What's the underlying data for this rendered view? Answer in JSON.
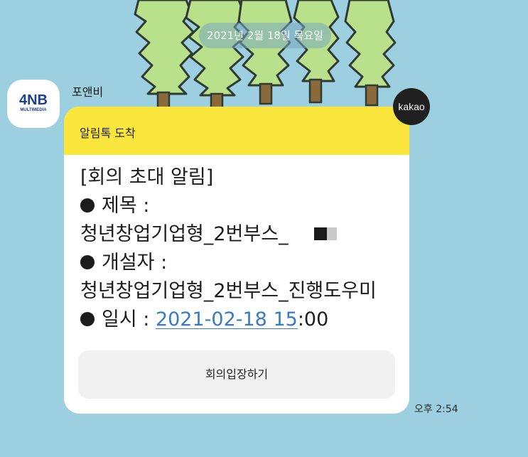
{
  "chat": {
    "date_divider": "2021년 2월 18일 목요일",
    "sender": {
      "name": "포앤비",
      "avatar_logo": "4NB",
      "avatar_logo_sub": "MULTIMEDIA"
    },
    "badge": "kakao",
    "message": {
      "header": "알림톡 도착",
      "title": "[회의 초대 알림]",
      "subject_label": "제목 :",
      "subject_value": "청년창업기업형_2번부스_",
      "creator_label": "개설자 :",
      "creator_value": "청년창업기업형_2번부스_진행도우미",
      "datetime_label": "일시 :",
      "datetime_link": "2021-02-18 15",
      "datetime_rest": ":00",
      "button_label": "회의입장하기"
    },
    "time": "오후 2:54"
  },
  "colors": {
    "background": "#9ccfe0",
    "header_yellow": "#fbe63d",
    "link_blue": "#3a7ac2",
    "brand_blue": "#1c3f8f"
  },
  "icons": [
    "bullet-icon",
    "tree-illustration"
  ]
}
